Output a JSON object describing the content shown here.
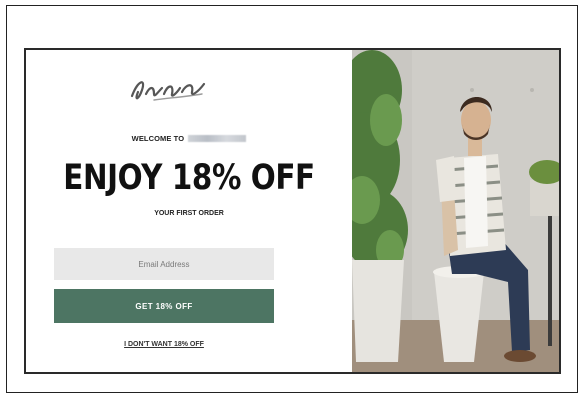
{
  "popup": {
    "welcome_label": "WELCOME TO",
    "headline": "ENJOY 18% OFF",
    "subheadline": "YOUR FIRST ORDER",
    "email_placeholder": "Email Address",
    "cta_label": "GET 18% OFF",
    "decline_label": "I DON'T WANT 18% OFF"
  },
  "colors": {
    "cta_background": "#4d7563",
    "input_background": "#e8e8e8"
  },
  "icons": {
    "logo": "script-brand-logo"
  }
}
